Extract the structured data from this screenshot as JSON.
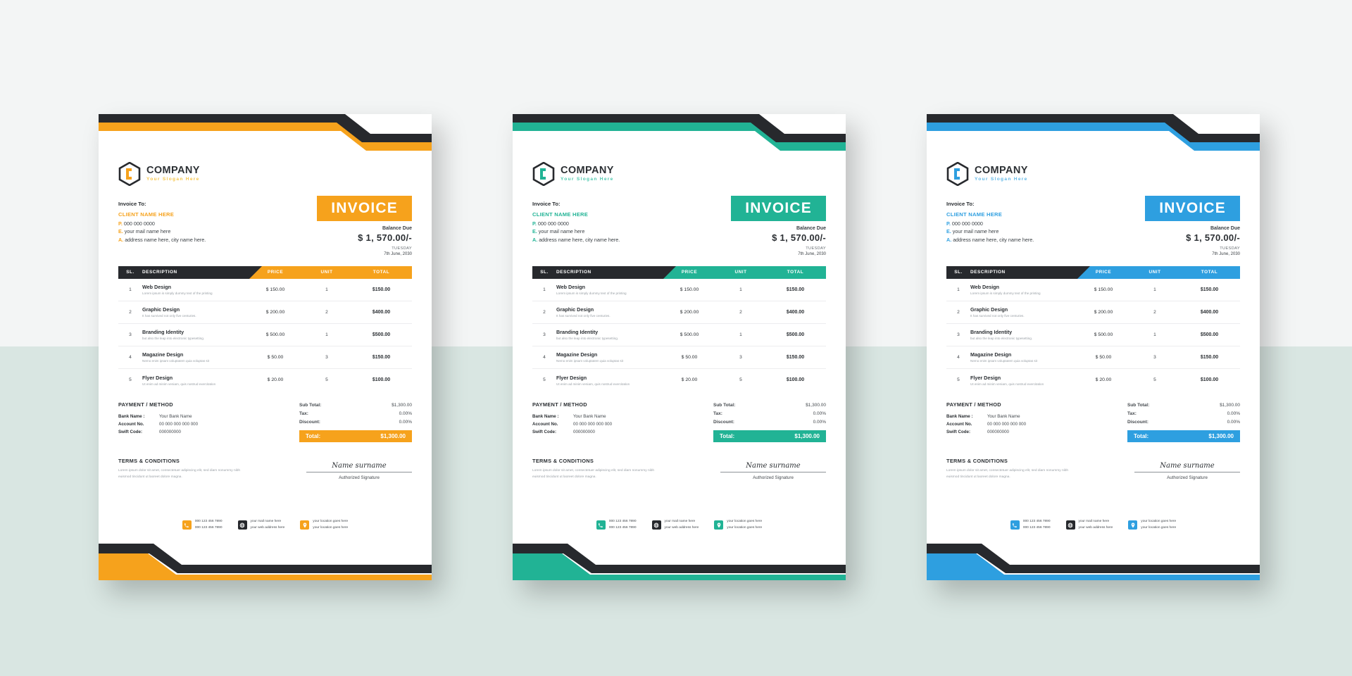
{
  "page": {
    "background_top": "#f3f5f5",
    "background_bottom": "#d9e6e2"
  },
  "brand": {
    "name": "COMPANY",
    "slogan": "Your Slogan Here",
    "logo_icon": "hexagon-logo-icon"
  },
  "invoice_to": {
    "label": "Invoice To:",
    "client": "CLIENT NAME HERE",
    "phone_prefix": "P.",
    "phone": "000 000 0000",
    "email_prefix": "E.",
    "email": "your mail name here",
    "address_prefix": "A.",
    "address": "address name here, city name here."
  },
  "invoice_header": {
    "banner": "INVOICE",
    "balance_label": "Balance Due",
    "balance_amount": "$ 1, 570.00/-",
    "day": "TUESDAY",
    "date": "7th June, 2030"
  },
  "table": {
    "columns": [
      "SL.",
      "DESCRIPTION",
      "PRICE",
      "UNIT",
      "TOTAL"
    ],
    "rows": [
      {
        "sl": "1",
        "title": "Web Design",
        "desc": "Lorem ipsum is simply dummy text of the printing",
        "price": "$ 150.00",
        "unit": "1",
        "total": "$150.00"
      },
      {
        "sl": "2",
        "title": "Graphic Design",
        "desc": "It has survived not only five centuries.",
        "price": "$ 200.00",
        "unit": "2",
        "total": "$400.00"
      },
      {
        "sl": "3",
        "title": "Branding Identity",
        "desc": "but also the leap into electronic typesetting.",
        "price": "$ 500.00",
        "unit": "1",
        "total": "$500.00"
      },
      {
        "sl": "4",
        "title": "Magazine Design",
        "desc": "Nemo enim ipsam voluptatem quia voluptas sit",
        "price": "$ 50.00",
        "unit": "3",
        "total": "$150.00"
      },
      {
        "sl": "5",
        "title": "Flyer Design",
        "desc": "Ut enim ad minim veniam, quis nostrud exercitation",
        "price": "$ 20.00",
        "unit": "5",
        "total": "$100.00"
      }
    ]
  },
  "payment": {
    "title": "PAYMENT / METHOD",
    "bank_name_label": "Bank Name :",
    "bank_name_value": "Your Bank Name",
    "account_label": "Account No.",
    "account_value": "00 000 000 000 000",
    "swift_label": "Swift Code:",
    "swift_value": "000000000"
  },
  "totals": {
    "sub_total_label": "Sub Total:",
    "sub_total_value": "$1,300.00",
    "tax_label": "Tax:",
    "tax_value": "0.00%",
    "discount_label": "Discount:",
    "discount_value": "0.00%",
    "total_label": "Total:",
    "total_value": "$1,300.00"
  },
  "terms": {
    "title": "TERMS & CONDITIONS",
    "body": "Lorem ipsum dolor sit amet, consectetuer adipiscing elit, sed diam nonummy nibh euismod tincidunt ut laoreet dolore magna.",
    "signature_name": "Name surname",
    "signature_label": "Authorized Signature"
  },
  "footer": {
    "phone_icon": "phone-icon",
    "phone_line1": "000 123 456 7890",
    "phone_line2": "000 123 456 7890",
    "web_icon": "globe-icon",
    "web_line1": "your mail name here",
    "web_line2": "your web address here",
    "location_icon": "location-pin-icon",
    "location_line1": "your location goes here",
    "location_line2": "your location goes here"
  },
  "variants": [
    {
      "id": "orange",
      "accent": "#f6a21c",
      "accent_dark": "#e8960f",
      "dark": "#27292d",
      "slogan_color": "#f6c64b"
    },
    {
      "id": "teal",
      "accent": "#21b395",
      "accent_dark": "#1aa086",
      "dark": "#27292d",
      "slogan_color": "#4fc9af"
    },
    {
      "id": "blue",
      "accent": "#2e9fe0",
      "accent_dark": "#1f8fd1",
      "dark": "#27292d",
      "slogan_color": "#63b9e8"
    }
  ]
}
